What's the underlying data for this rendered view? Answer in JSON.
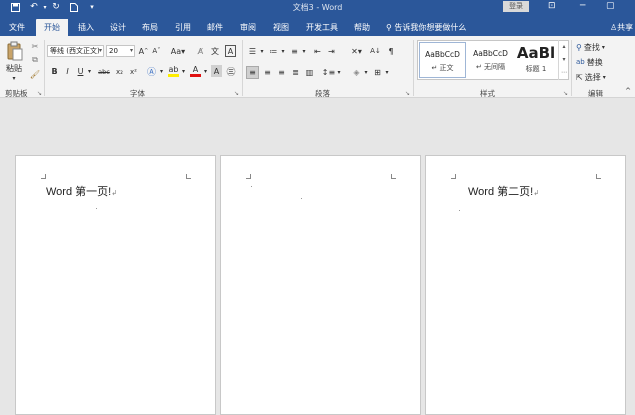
{
  "titlebar": {
    "title": "文档3 - Word",
    "login": "登录",
    "icons": [
      "save-icon",
      "undo-icon",
      "redo-icon",
      "new-doc-icon",
      "qat-dropdown-icon"
    ]
  },
  "tabs": [
    {
      "label": "文件",
      "active": false
    },
    {
      "label": "开始",
      "active": true
    },
    {
      "label": "插入",
      "active": false
    },
    {
      "label": "设计",
      "active": false
    },
    {
      "label": "布局",
      "active": false
    },
    {
      "label": "引用",
      "active": false
    },
    {
      "label": "邮件",
      "active": false
    },
    {
      "label": "审阅",
      "active": false
    },
    {
      "label": "视图",
      "active": false
    },
    {
      "label": "开发工具",
      "active": false
    },
    {
      "label": "帮助",
      "active": false
    }
  ],
  "tellme": "告诉我你想要做什么",
  "share": "共享",
  "ribbon": {
    "clipboard": {
      "label": "剪贴板",
      "paste": "粘贴"
    },
    "font": {
      "label": "字体",
      "font_name": "等线 (西文正文)",
      "font_size": "20",
      "bold": "B",
      "italic": "I",
      "underline": "U",
      "strike": "abc",
      "subscript": "x₂",
      "superscript": "x²"
    },
    "paragraph": {
      "label": "段落"
    },
    "styles": {
      "label": "样式",
      "items": [
        {
          "sample": "AaBbCcD",
          "name": "↵ 正文"
        },
        {
          "sample": "AaBbCcD",
          "name": "↵ 无间隔"
        },
        {
          "sample": "AaBl",
          "name": "标题 1"
        }
      ]
    },
    "editing": {
      "label": "编辑",
      "find": "查找",
      "replace": "替换",
      "select": "选择"
    }
  },
  "pages": [
    {
      "text": "Word 第一页!"
    },
    {
      "text": ""
    },
    {
      "text": "Word 第二页!"
    }
  ],
  "colors": {
    "brand": "#2b579a",
    "ribbon_bg": "#f3f3f3",
    "workspace_bg": "#e6e6e6"
  }
}
